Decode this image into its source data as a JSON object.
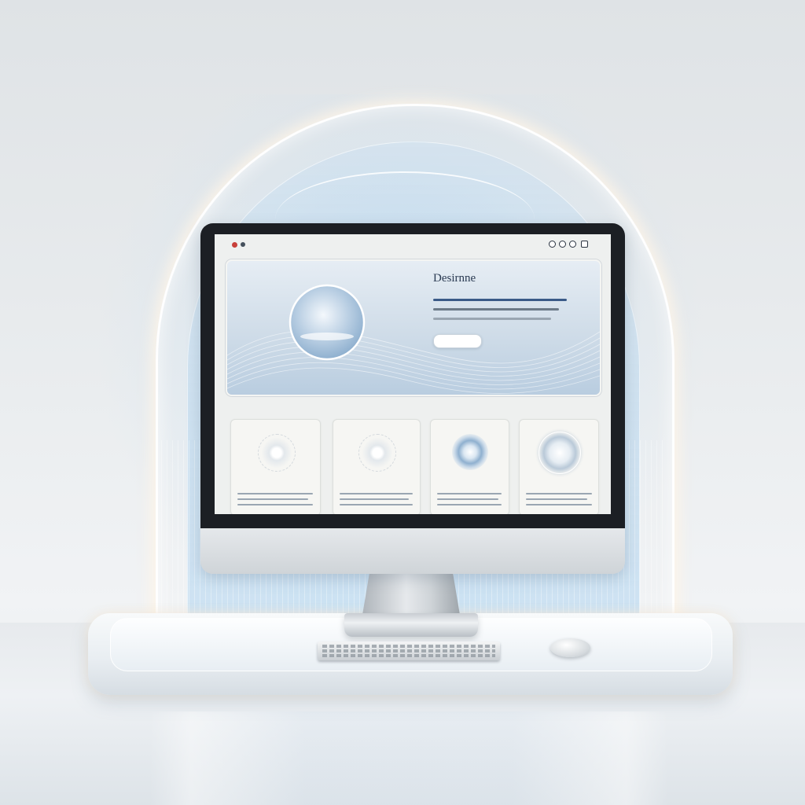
{
  "hero": {
    "title": "Desirnne"
  },
  "colors": {
    "accent": "#2a3a52",
    "screen_bg": "#eef0ef",
    "hero_blue": "#b9cde0",
    "link_blue": "#3a5a88",
    "traffic_red": "#c8403a",
    "traffic_dark": "#44505c"
  },
  "icons": [
    "close-dot-icon",
    "minimize-dot-icon",
    "account-icon",
    "shield-icon",
    "globe-icon",
    "menu-icon",
    "orb-icon",
    "keyboard-icon",
    "mouse-icon"
  ]
}
